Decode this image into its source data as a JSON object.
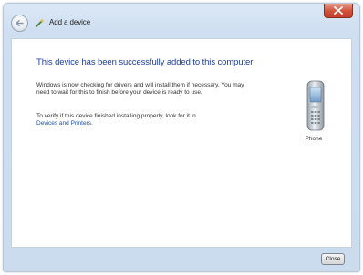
{
  "window": {
    "title": "Add a device",
    "accent_color": "#1e3f9a",
    "close_button_color": "#c63f2a"
  },
  "content": {
    "heading": "This device has been successfully added to this computer",
    "paragraph1": "Windows is now checking for drivers and will install them if necessary. You may need to wait for this to finish before your device is ready to use.",
    "paragraph2_text": "To verify if this device finished installing properly, look for it in",
    "paragraph2_link": "Devices and Printers."
  },
  "device": {
    "icon": "phone-icon",
    "label": "Phone"
  },
  "footer": {
    "close_label": "Close"
  }
}
